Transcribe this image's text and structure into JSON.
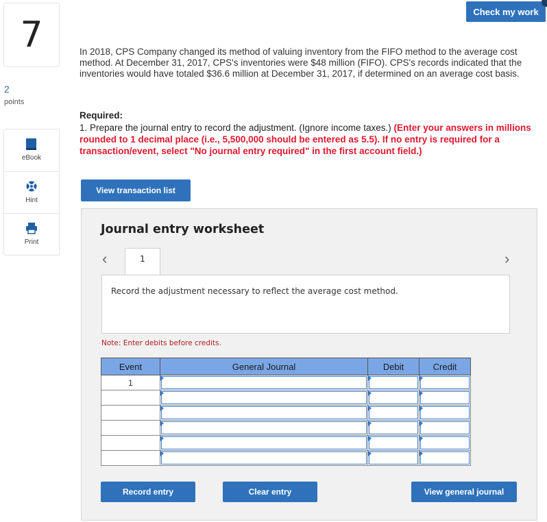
{
  "question": {
    "number": "7",
    "points_value": "2",
    "points_label": "points",
    "text": "In 2018, CPS Company changed its method of valuing inventory from the FIFO method to the average cost method. At December 31, 2017, CPS's inventories were $48 million (FIFO). CPS's records indicated that the inventories would have totaled $36.6 million at December 31, 2017, if determined on an average cost basis.",
    "required_title": "Required:",
    "required_text": "1. Prepare the journal entry to record the adjustment. (Ignore income taxes.) ",
    "required_instructions": "(Enter your answers in millions rounded to 1 decimal place (i.e., 5,500,000 should be entered as 5.5). If no entry is required for a transaction/event, select \"No journal entry required\" in the first account field.)"
  },
  "tools": {
    "ebook": "eBook",
    "hint": "Hint",
    "print": "Print"
  },
  "check_my_work": "Check my work",
  "view_transaction_list": "View transaction list",
  "worksheet": {
    "title": "Journal entry worksheet",
    "tab_label": "1",
    "description": "Record the adjustment necessary to reflect the average cost method.",
    "note": "Note: Enter debits before credits.",
    "columns": [
      "Event",
      "General Journal",
      "Debit",
      "Credit"
    ],
    "rows": [
      {
        "event": "1",
        "account": "",
        "debit": "",
        "credit": ""
      },
      {
        "event": "",
        "account": "",
        "debit": "",
        "credit": ""
      },
      {
        "event": "",
        "account": "",
        "debit": "",
        "credit": ""
      },
      {
        "event": "",
        "account": "",
        "debit": "",
        "credit": ""
      },
      {
        "event": "",
        "account": "",
        "debit": "",
        "credit": ""
      },
      {
        "event": "",
        "account": "",
        "debit": "",
        "credit": ""
      }
    ],
    "record_entry": "Record entry",
    "clear_entry": "Clear entry",
    "view_general_journal": "View general journal"
  },
  "colors": {
    "button_blue": "#2f72bb",
    "header_blue": "#7aa6e6",
    "required_red": "#e0182d",
    "note_red": "#b01c1c"
  }
}
